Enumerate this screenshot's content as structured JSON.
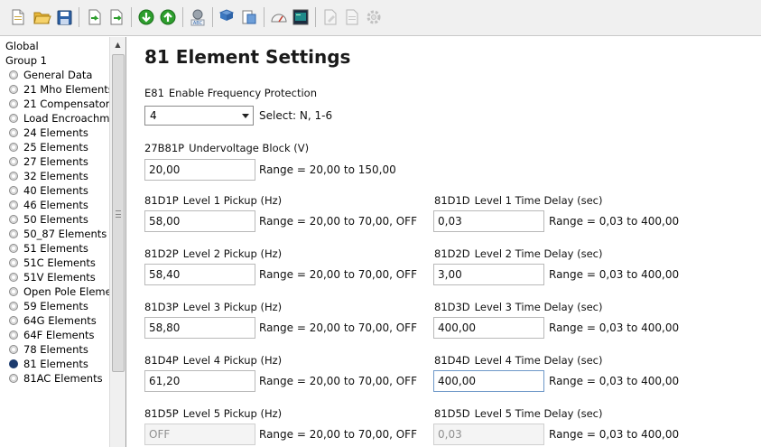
{
  "tree": {
    "items": [
      {
        "label": "Global",
        "level": "root"
      },
      {
        "label": "Group 1",
        "level": "root"
      },
      {
        "label": "General Data",
        "level": "child"
      },
      {
        "label": "21 Mho Elements",
        "level": "child"
      },
      {
        "label": "21 Compensator",
        "level": "child"
      },
      {
        "label": "Load Encroachment",
        "level": "child"
      },
      {
        "label": "24 Elements",
        "level": "child"
      },
      {
        "label": "25 Elements",
        "level": "child"
      },
      {
        "label": "27 Elements",
        "level": "child"
      },
      {
        "label": "32 Elements",
        "level": "child"
      },
      {
        "label": "40 Elements",
        "level": "child"
      },
      {
        "label": "46 Elements",
        "level": "child"
      },
      {
        "label": "50 Elements",
        "level": "child"
      },
      {
        "label": "50_87 Elements",
        "level": "child"
      },
      {
        "label": "51 Elements",
        "level": "child"
      },
      {
        "label": "51C Elements",
        "level": "child"
      },
      {
        "label": "51V Elements",
        "level": "child"
      },
      {
        "label": "Open Pole Elements",
        "level": "child"
      },
      {
        "label": "59 Elements",
        "level": "child"
      },
      {
        "label": "64G Elements",
        "level": "child"
      },
      {
        "label": "64F Elements",
        "level": "child"
      },
      {
        "label": "78 Elements",
        "level": "child"
      },
      {
        "label": "81 Elements",
        "level": "child",
        "active": true
      },
      {
        "label": "81AC Elements",
        "level": "child"
      }
    ]
  },
  "page": {
    "title": "81 Element Settings"
  },
  "e81": {
    "code": "E81",
    "label": "Enable Frequency Protection",
    "value": "4",
    "hint": "Select: N, 1-6"
  },
  "uv": {
    "code": "27B81P",
    "label": "Undervoltage Block (V)",
    "value": "20,00",
    "range": "Range = 20,00 to 150,00"
  },
  "levels": [
    {
      "pickup": {
        "code": "81D1P",
        "label": "Level 1 Pickup (Hz)",
        "value": "58,00",
        "range": "Range = 20,00 to 70,00, OFF"
      },
      "delay": {
        "code": "81D1D",
        "label": "Level 1 Time Delay (sec)",
        "value": "0,03",
        "range": "Range = 0,03 to 400,00"
      }
    },
    {
      "pickup": {
        "code": "81D2P",
        "label": "Level 2 Pickup (Hz)",
        "value": "58,40",
        "range": "Range = 20,00 to 70,00, OFF"
      },
      "delay": {
        "code": "81D2D",
        "label": "Level 2 Time Delay (sec)",
        "value": "3,00",
        "range": "Range = 0,03 to 400,00"
      }
    },
    {
      "pickup": {
        "code": "81D3P",
        "label": "Level 3 Pickup (Hz)",
        "value": "58,80",
        "range": "Range = 20,00 to 70,00, OFF"
      },
      "delay": {
        "code": "81D3D",
        "label": "Level 3 Time Delay (sec)",
        "value": "400,00",
        "range": "Range = 0,03 to 400,00"
      }
    },
    {
      "pickup": {
        "code": "81D4P",
        "label": "Level 4 Pickup (Hz)",
        "value": "61,20",
        "range": "Range = 20,00 to 70,00, OFF"
      },
      "delay": {
        "code": "81D4D",
        "label": "Level 4 Time Delay (sec)",
        "value": "400,00",
        "range": "Range = 0,03 to 400,00"
      }
    },
    {
      "pickup": {
        "code": "81D5P",
        "label": "Level 5 Pickup (Hz)",
        "value": "OFF",
        "range": "Range = 20,00 to 70,00, OFF"
      },
      "delay": {
        "code": "81D5D",
        "label": "Level 5 Time Delay (sec)",
        "value": "0,03",
        "range": "Range = 0,03 to 400,00"
      }
    }
  ],
  "colors": {
    "toolbar_bg": "#f0f0f0",
    "active_bullet": "#1c3b6e",
    "green_nav": "#2e9e2e"
  }
}
